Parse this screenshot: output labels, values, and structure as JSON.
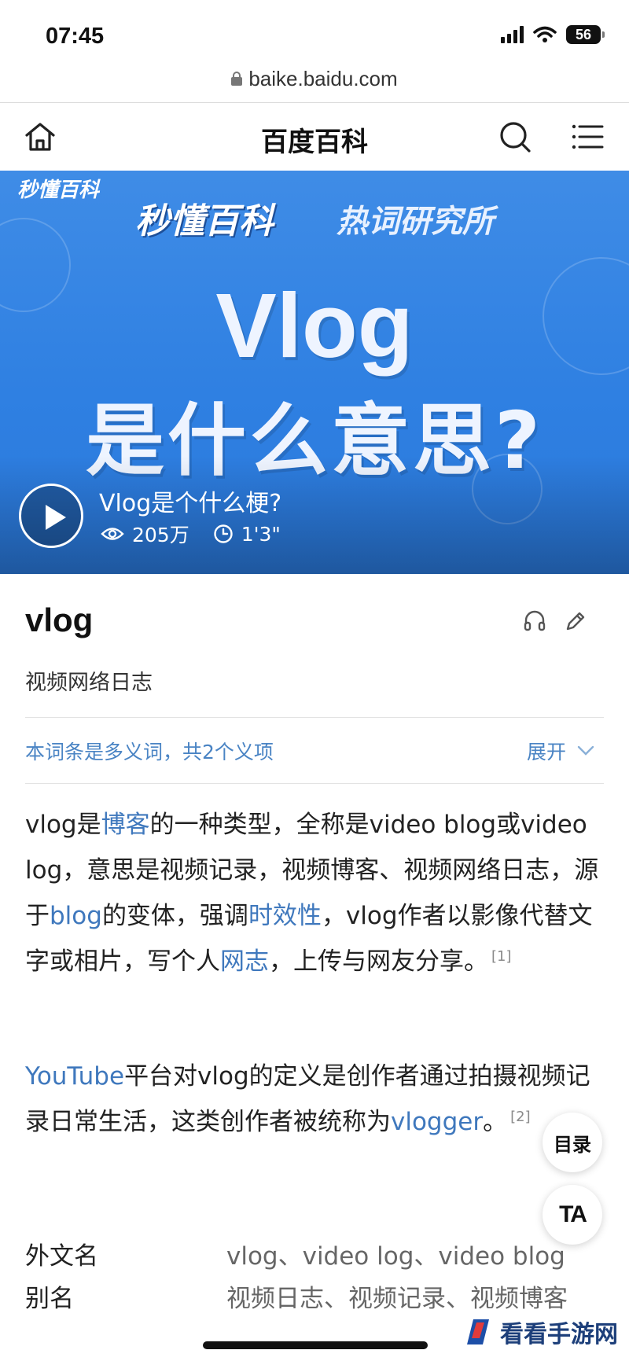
{
  "status_bar": {
    "time": "07:45",
    "battery": "56",
    "url": "baike.baidu.com"
  },
  "nav": {
    "title": "百度百科",
    "icons": [
      "home-icon",
      "search-icon",
      "menu-icon"
    ]
  },
  "hero": {
    "brand_small": "秒懂百科",
    "brand": "秒懂百科",
    "brand_sub": "热词研究所",
    "headline_line1": "Vlog",
    "headline_line2": "是什么意思?",
    "video_title": "Vlog是个什么梗?",
    "views": "205万",
    "duration": "1'3\""
  },
  "entry": {
    "title": "vlog",
    "subtitle": "视频网络日志",
    "polysemy": "本词条是多义词，共2个义项",
    "expand_label": "展开"
  },
  "paragraph1": {
    "t1": "vlog是",
    "link1": "博客",
    "t2": "的一种类型，全称是video blog或video log，意思是视频记录，视频博客、视频网络日志，源于",
    "link2": "blog",
    "t3": "的变体，强调",
    "link3": "时效性",
    "t4": "，vlog作者以影像代替文字或相片，写个人",
    "link4": "网志",
    "t5": "，上传与网友分享。",
    "ref": "[1]"
  },
  "paragraph2": {
    "link1": "YouTube",
    "t1": "平台对vlog的定义是创作者通过拍摄视频记录日常生活，这类创作者被统称为",
    "link2": "vlogger",
    "t2": "。",
    "ref": "[2]"
  },
  "floating": {
    "toc": "目录",
    "font_size": "TA"
  },
  "info": {
    "foreign_label": "外文名",
    "foreign_value": "vlog、video log、video blog",
    "alias_label": "别名",
    "alias_value": "视频日志、视频记录、视频博客"
  },
  "watermark": {
    "text": "看看手游网"
  },
  "colors": {
    "link": "#3f78bd",
    "hero_blue": "#2f80e2"
  }
}
